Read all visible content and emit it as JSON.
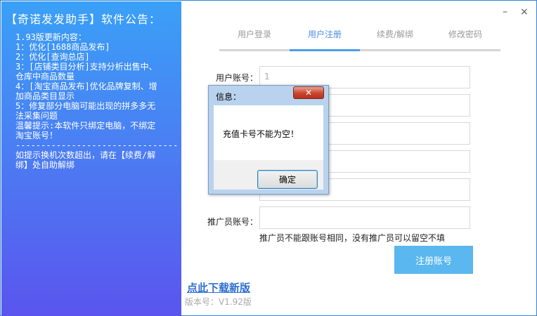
{
  "announcement": {
    "title": "【奇诺发发助手】软件公告：",
    "lines": [
      "1.93版更新内容：",
      "1：优化[1688商品发布]",
      "",
      "2：优化[查询总店]",
      "",
      "3：[店铺类目分析]支持分析出售中、",
      "仓库中商品数量",
      "",
      "4：[淘宝商品发布]优化品牌复制、增",
      "加商品类目显示",
      "",
      "5：修复部分电脑可能出现的拼多多无",
      "法采集问题",
      "",
      "",
      "温馨提示:本软件只绑定电脑，不绑定",
      "淘宝账号！",
      "--------------------------------",
      "",
      "如提示换机次数超出，请在【续费/解",
      "绑】处自助解绑"
    ]
  },
  "window": {
    "minimize": "–",
    "close": "×"
  },
  "tabs": [
    {
      "label": "用户登录"
    },
    {
      "label": "用户注册"
    },
    {
      "label": "续费/解绑"
    },
    {
      "label": "修改密码"
    }
  ],
  "form": {
    "account_label": "用户账号：",
    "account_value": "1",
    "referrer_label": "推广员账号：",
    "referrer_value": "",
    "hint": "推广员不能跟账号相同，没有推广员可以留空不填",
    "register_button": "注册账号"
  },
  "footer": {
    "link": "点此下载新版",
    "version": "版本号：V1.92版"
  },
  "dialog": {
    "title": "信息：",
    "close_label": "✕",
    "message": "充值卡号不能为空！",
    "ok_button": "确定"
  },
  "colors": {
    "accent": "#4a9de8",
    "button": "#5ab7ef",
    "panel_top": "#3aa0f7",
    "panel_bottom": "#5a55ee"
  }
}
